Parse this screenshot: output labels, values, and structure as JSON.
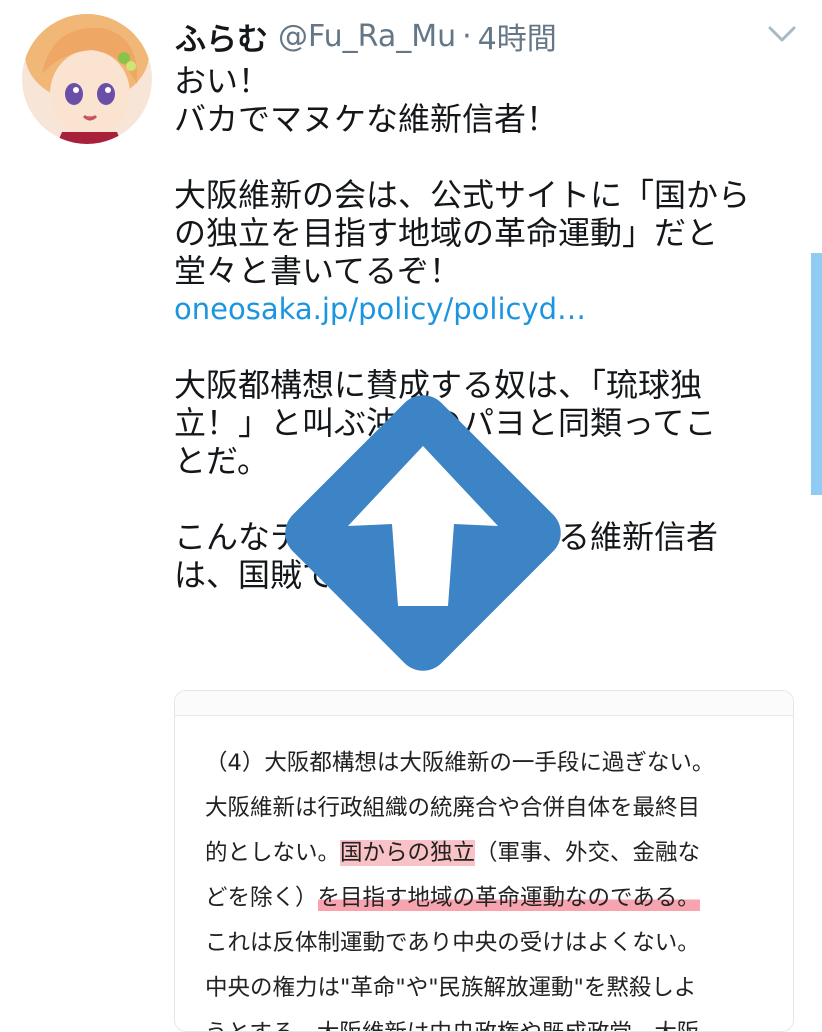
{
  "user": {
    "display_name": "ふらむ",
    "handle": "@Fu_Ra_Mu",
    "separator": "·",
    "time": "4時間"
  },
  "tweet": {
    "lines": [
      "おい！",
      "バカでマヌケな維新信者！",
      "",
      "大阪維新の会は、公式サイトに「国から",
      "の独立を目指す地域の革命運動」だと",
      "堂々と書いてるぞ！"
    ],
    "link": "oneosaka.jp/policy/policyd…",
    "lines2": [
      "",
      "大阪都構想に賛成する奴は、「琉球独",
      "立！」と叫ぶ沖縄のパヨと同類ってこ",
      "とだ。",
      "",
      "こんなテロ組織を持ち上げる維新信者",
      "は、国賊でしかない。"
    ]
  },
  "media": {
    "line1": "（4）大阪都構想は大阪維新の一手段に過ぎない。",
    "line2": "大阪維新は行政組織の統廃合や合併自体を最終目",
    "line3_pre": "的としない。",
    "line3_hl": "国からの独立",
    "line3_post": "（軍事、外交、金融な",
    "line4_pre": "どを除く）",
    "line4_hl": "を目指す地域の革命運動なのである。",
    "line5": "これは反体制運動であり中央の受けはよくない。",
    "line6": "中央の権力は\"革命\"や\"民族解放運動\"を黙殺しよ",
    "line7": "うとする。大阪維新は中央政権や既成政党、大阪"
  },
  "colors": {
    "link": "#1b95e0",
    "secondary_text": "#657786",
    "overlay_blue": "#3d84c6",
    "highlight": "#f07882"
  },
  "icons": {
    "menu": "chevron-down-icon",
    "overlay": "upload-arrow-icon"
  }
}
